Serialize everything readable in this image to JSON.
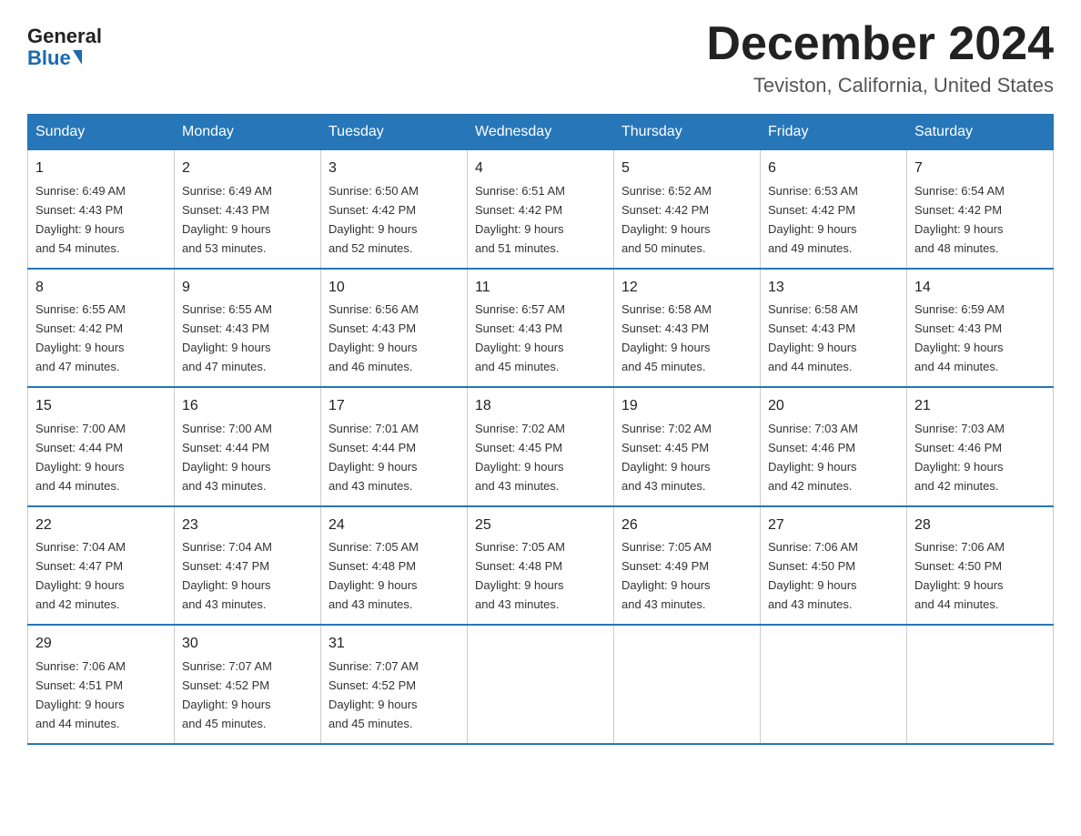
{
  "header": {
    "logo_general": "General",
    "logo_blue": "Blue",
    "month_title": "December 2024",
    "location": "Teviston, California, United States"
  },
  "weekdays": [
    "Sunday",
    "Monday",
    "Tuesday",
    "Wednesday",
    "Thursday",
    "Friday",
    "Saturday"
  ],
  "weeks": [
    [
      {
        "day": "1",
        "sunrise": "6:49 AM",
        "sunset": "4:43 PM",
        "daylight": "9 hours and 54 minutes."
      },
      {
        "day": "2",
        "sunrise": "6:49 AM",
        "sunset": "4:43 PM",
        "daylight": "9 hours and 53 minutes."
      },
      {
        "day": "3",
        "sunrise": "6:50 AM",
        "sunset": "4:42 PM",
        "daylight": "9 hours and 52 minutes."
      },
      {
        "day": "4",
        "sunrise": "6:51 AM",
        "sunset": "4:42 PM",
        "daylight": "9 hours and 51 minutes."
      },
      {
        "day": "5",
        "sunrise": "6:52 AM",
        "sunset": "4:42 PM",
        "daylight": "9 hours and 50 minutes."
      },
      {
        "day": "6",
        "sunrise": "6:53 AM",
        "sunset": "4:42 PM",
        "daylight": "9 hours and 49 minutes."
      },
      {
        "day": "7",
        "sunrise": "6:54 AM",
        "sunset": "4:42 PM",
        "daylight": "9 hours and 48 minutes."
      }
    ],
    [
      {
        "day": "8",
        "sunrise": "6:55 AM",
        "sunset": "4:42 PM",
        "daylight": "9 hours and 47 minutes."
      },
      {
        "day": "9",
        "sunrise": "6:55 AM",
        "sunset": "4:43 PM",
        "daylight": "9 hours and 47 minutes."
      },
      {
        "day": "10",
        "sunrise": "6:56 AM",
        "sunset": "4:43 PM",
        "daylight": "9 hours and 46 minutes."
      },
      {
        "day": "11",
        "sunrise": "6:57 AM",
        "sunset": "4:43 PM",
        "daylight": "9 hours and 45 minutes."
      },
      {
        "day": "12",
        "sunrise": "6:58 AM",
        "sunset": "4:43 PM",
        "daylight": "9 hours and 45 minutes."
      },
      {
        "day": "13",
        "sunrise": "6:58 AM",
        "sunset": "4:43 PM",
        "daylight": "9 hours and 44 minutes."
      },
      {
        "day": "14",
        "sunrise": "6:59 AM",
        "sunset": "4:43 PM",
        "daylight": "9 hours and 44 minutes."
      }
    ],
    [
      {
        "day": "15",
        "sunrise": "7:00 AM",
        "sunset": "4:44 PM",
        "daylight": "9 hours and 44 minutes."
      },
      {
        "day": "16",
        "sunrise": "7:00 AM",
        "sunset": "4:44 PM",
        "daylight": "9 hours and 43 minutes."
      },
      {
        "day": "17",
        "sunrise": "7:01 AM",
        "sunset": "4:44 PM",
        "daylight": "9 hours and 43 minutes."
      },
      {
        "day": "18",
        "sunrise": "7:02 AM",
        "sunset": "4:45 PM",
        "daylight": "9 hours and 43 minutes."
      },
      {
        "day": "19",
        "sunrise": "7:02 AM",
        "sunset": "4:45 PM",
        "daylight": "9 hours and 43 minutes."
      },
      {
        "day": "20",
        "sunrise": "7:03 AM",
        "sunset": "4:46 PM",
        "daylight": "9 hours and 42 minutes."
      },
      {
        "day": "21",
        "sunrise": "7:03 AM",
        "sunset": "4:46 PM",
        "daylight": "9 hours and 42 minutes."
      }
    ],
    [
      {
        "day": "22",
        "sunrise": "7:04 AM",
        "sunset": "4:47 PM",
        "daylight": "9 hours and 42 minutes."
      },
      {
        "day": "23",
        "sunrise": "7:04 AM",
        "sunset": "4:47 PM",
        "daylight": "9 hours and 43 minutes."
      },
      {
        "day": "24",
        "sunrise": "7:05 AM",
        "sunset": "4:48 PM",
        "daylight": "9 hours and 43 minutes."
      },
      {
        "day": "25",
        "sunrise": "7:05 AM",
        "sunset": "4:48 PM",
        "daylight": "9 hours and 43 minutes."
      },
      {
        "day": "26",
        "sunrise": "7:05 AM",
        "sunset": "4:49 PM",
        "daylight": "9 hours and 43 minutes."
      },
      {
        "day": "27",
        "sunrise": "7:06 AM",
        "sunset": "4:50 PM",
        "daylight": "9 hours and 43 minutes."
      },
      {
        "day": "28",
        "sunrise": "7:06 AM",
        "sunset": "4:50 PM",
        "daylight": "9 hours and 44 minutes."
      }
    ],
    [
      {
        "day": "29",
        "sunrise": "7:06 AM",
        "sunset": "4:51 PM",
        "daylight": "9 hours and 44 minutes."
      },
      {
        "day": "30",
        "sunrise": "7:07 AM",
        "sunset": "4:52 PM",
        "daylight": "9 hours and 45 minutes."
      },
      {
        "day": "31",
        "sunrise": "7:07 AM",
        "sunset": "4:52 PM",
        "daylight": "9 hours and 45 minutes."
      },
      null,
      null,
      null,
      null
    ]
  ],
  "labels": {
    "sunrise": "Sunrise: ",
    "sunset": "Sunset: ",
    "daylight": "Daylight: 9 hours"
  }
}
